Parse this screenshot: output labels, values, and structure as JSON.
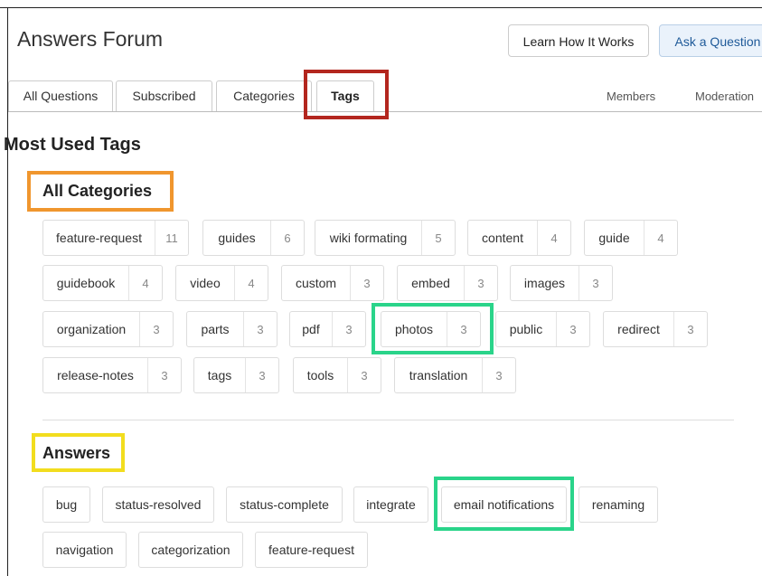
{
  "header": {
    "title": "Answers Forum",
    "learn_button": "Learn How It Works",
    "ask_button": "Ask a Question"
  },
  "tabs": {
    "all_questions": "All Questions",
    "subscribed": "Subscribed",
    "categories": "Categories",
    "tags": "Tags",
    "members": "Members",
    "moderation": "Moderation"
  },
  "main": {
    "section_title": "Most Used Tags",
    "all_categories": {
      "title": "All Categories",
      "tags": [
        {
          "name": "feature-request",
          "count": "11"
        },
        {
          "name": "guides",
          "count": "6"
        },
        {
          "name": "wiki formating",
          "count": "5"
        },
        {
          "name": "content",
          "count": "4"
        },
        {
          "name": "guide",
          "count": "4"
        },
        {
          "name": "guidebook",
          "count": "4"
        },
        {
          "name": "video",
          "count": "4"
        },
        {
          "name": "custom",
          "count": "3"
        },
        {
          "name": "embed",
          "count": "3"
        },
        {
          "name": "images",
          "count": "3"
        },
        {
          "name": "organization",
          "count": "3"
        },
        {
          "name": "parts",
          "count": "3"
        },
        {
          "name": "pdf",
          "count": "3"
        },
        {
          "name": "photos",
          "count": "3"
        },
        {
          "name": "public",
          "count": "3"
        },
        {
          "name": "redirect",
          "count": "3"
        },
        {
          "name": "release-notes",
          "count": "3"
        },
        {
          "name": "tags",
          "count": "3"
        },
        {
          "name": "tools",
          "count": "3"
        },
        {
          "name": "translation",
          "count": "3"
        }
      ]
    },
    "answers": {
      "title": "Answers",
      "tags": [
        {
          "name": "bug"
        },
        {
          "name": "status-resolved"
        },
        {
          "name": "status-complete"
        },
        {
          "name": "integrate"
        },
        {
          "name": "email notifications"
        },
        {
          "name": "renaming"
        },
        {
          "name": "navigation"
        },
        {
          "name": "categorization"
        },
        {
          "name": "feature-request"
        }
      ]
    }
  },
  "highlight_colors": {
    "red": "#b3261e",
    "orange": "#f0962e",
    "yellow": "#f2dd1e",
    "green": "#2ad48a"
  }
}
